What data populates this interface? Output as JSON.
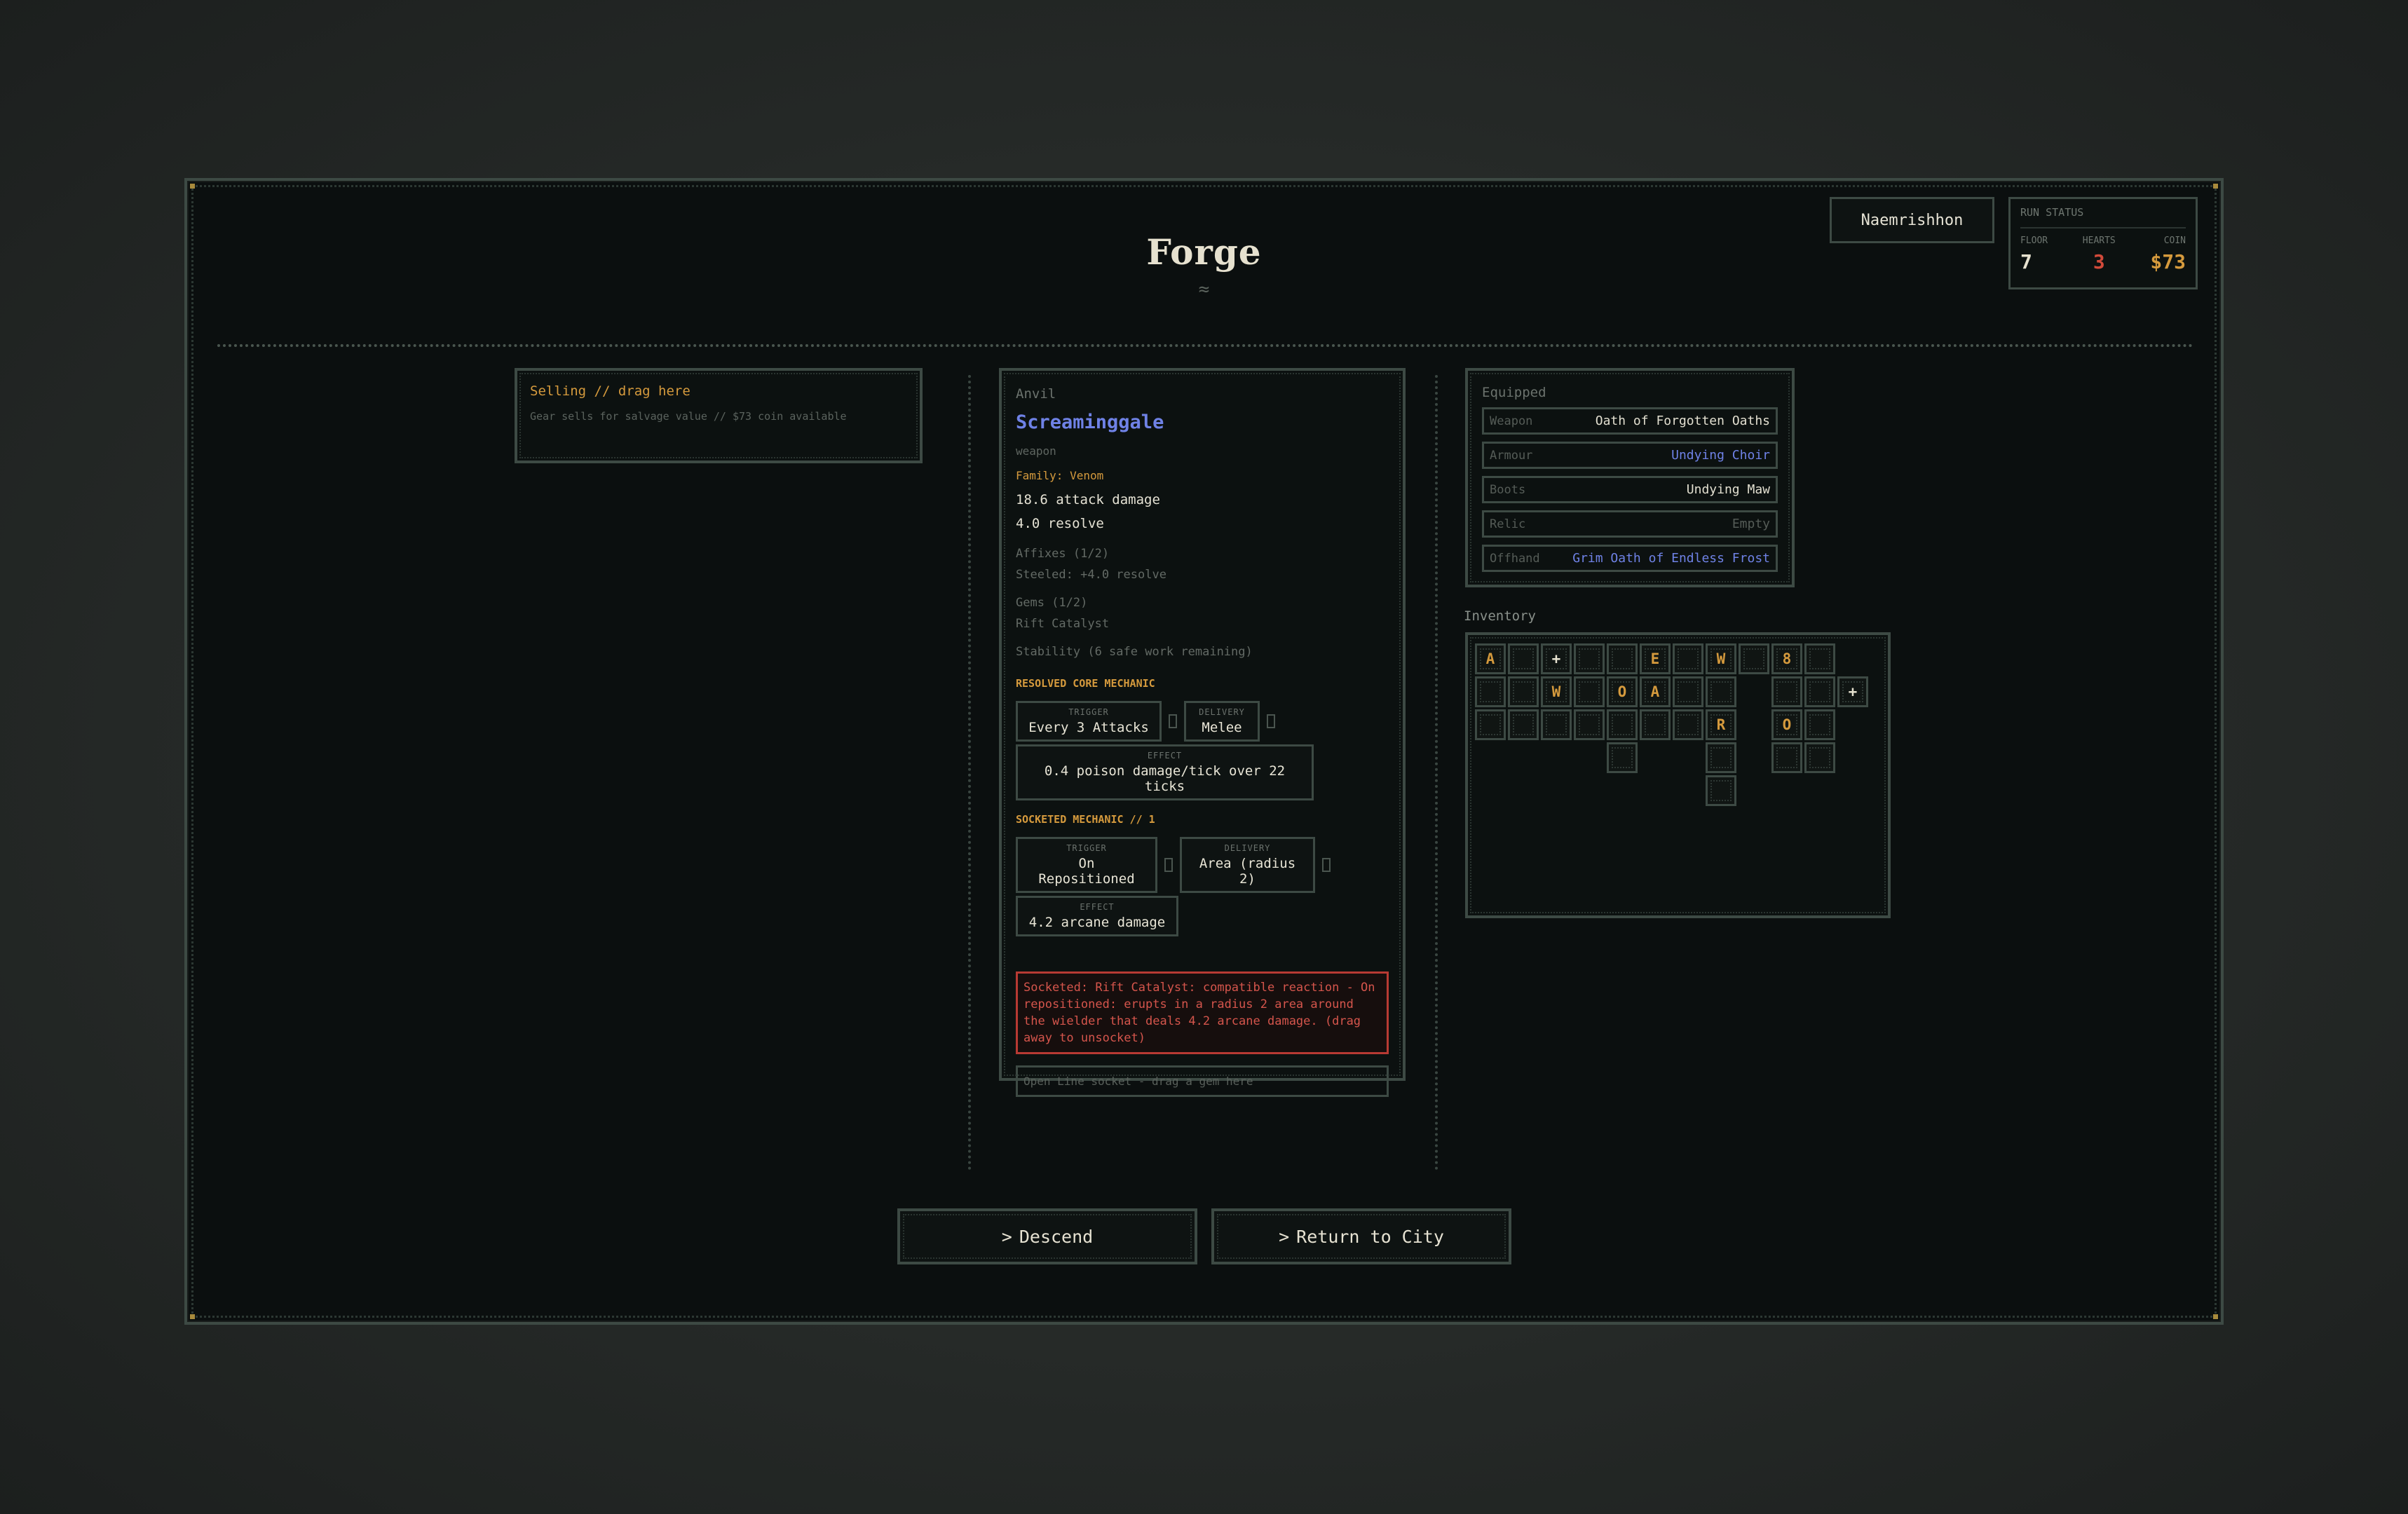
{
  "header": {
    "title": "Forge",
    "title_ornament": "≈"
  },
  "player": {
    "name": "Naemrishhon"
  },
  "run_status": {
    "label": "RUN STATUS",
    "floor_label": "FLOOR",
    "floor_value": "7",
    "hearts_label": "HEARTS",
    "hearts_value": "3",
    "coin_label": "COIN",
    "coin_value": "$73"
  },
  "selling": {
    "title": "Selling // drag here",
    "subtitle": "Gear sells for salvage value // $73 coin available"
  },
  "anvil": {
    "label": "Anvil",
    "item_name": "Screaminggale",
    "item_kind": "weapon",
    "family": "Family: Venom",
    "stats": [
      "18.6 attack damage",
      "4.0 resolve"
    ],
    "affixes": "Affixes (1/2)",
    "affix_line": "Steeled: +4.0 resolve",
    "gems": "Gems (1/2)",
    "gem_line": "Rift Catalyst",
    "stability": "Stability (6 safe work remaining)",
    "core_section": "RESOLVED CORE MECHANIC",
    "core": {
      "trigger_label": "TRIGGER",
      "trigger": "Every 3 Attacks",
      "delivery_label": "DELIVERY",
      "delivery": "Melee",
      "effect_label": "EFFECT",
      "effect": "0.4 poison damage/tick over 22 ticks"
    },
    "socket_section": "SOCKETED MECHANIC // 1",
    "socketed": {
      "trigger_label": "TRIGGER",
      "trigger": "On Repositioned",
      "delivery_label": "DELIVERY",
      "delivery": "Area (radius 2)",
      "effect_label": "EFFECT",
      "effect": "4.2 arcane damage"
    },
    "warning": "Socketed: Rift Catalyst: compatible reaction - On repositioned: erupts in a radius 2 area around the wielder that deals 4.2 arcane damage. (drag away to unsocket)",
    "open_socket": "Open Line socket - drag a gem here"
  },
  "equipped": {
    "title": "Equipped",
    "slots": [
      {
        "slot": "Weapon",
        "item": "Oath of Forgotten Oaths",
        "color": "#e2dfd0"
      },
      {
        "slot": "Armour",
        "item": "Undying Choir",
        "color": "#6f82e6"
      },
      {
        "slot": "Boots",
        "item": "Undying Maw",
        "color": "#e2dfd0"
      },
      {
        "slot": "Relic",
        "item": "Empty",
        "color": "#555c57"
      },
      {
        "slot": "Offhand",
        "item": "Grim Oath of Endless Frost",
        "color": "#6f82e6"
      }
    ]
  },
  "inventory": {
    "title": "Inventory",
    "glyphs": [
      "A",
      "+",
      "E",
      "W",
      "8",
      "W",
      "O",
      "A",
      "+",
      "R",
      "O"
    ]
  },
  "actions": {
    "descend": "Descend",
    "return": "Return to City",
    "chevron": ">"
  },
  "colors": {
    "accent_gold": "#d59a3d",
    "rare_blue": "#6f82e6",
    "danger_red": "#d5554c",
    "hearts_red": "#d24a3a"
  }
}
